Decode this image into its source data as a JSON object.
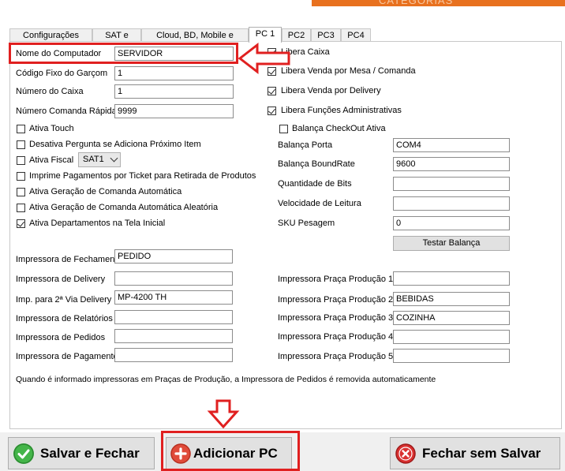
{
  "window": {
    "partial_title": "CATEGORIAS",
    "accent": "#e8711f"
  },
  "tabs": [
    {
      "label": "Configurações Gerais"
    },
    {
      "label": "SAT e CFE"
    },
    {
      "label": "Cloud, BD, Mobile e Balança"
    },
    {
      "label": "PC 1"
    },
    {
      "label": "PC2"
    },
    {
      "label": "PC3"
    },
    {
      "label": "PC4"
    }
  ],
  "left": {
    "nome_computador": {
      "label": "Nome do Computador",
      "value": "SERVIDOR"
    },
    "codigo_garcom": {
      "label": "Código Fixo do Garçom",
      "value": "1"
    },
    "numero_caixa": {
      "label": "Número do Caixa",
      "value": "1"
    },
    "numero_comanda": {
      "label": "Número Comanda Rápida",
      "value": "9999"
    },
    "ativa_touch": {
      "label": "Ativa Touch",
      "checked": false
    },
    "desativa_pergunta": {
      "label": "Desativa Pergunta se Adiciona Próximo Item",
      "checked": false
    },
    "ativa_fiscal": {
      "label": "Ativa Fiscal",
      "checked": false,
      "combo": "SAT1"
    },
    "imprime_pagamentos": {
      "label": "Imprime Pagamentos por Ticket para Retirada de Produtos",
      "checked": false
    },
    "ativa_comanda_auto": {
      "label": "Ativa Geração de Comanda Automática",
      "checked": false
    },
    "ativa_comanda_aleatoria": {
      "label": "Ativa Geração de Comanda Automática Aleatória",
      "checked": false
    },
    "ativa_departamentos": {
      "label": "Ativa Departamentos na Tela Inicial",
      "checked": true
    },
    "imp_fechamento": {
      "label": "Impressora de Fechamento",
      "value": "PEDIDO"
    },
    "imp_delivery": {
      "label": "Impressora de Delivery",
      "value": ""
    },
    "imp_segunda_via": {
      "label": "Imp. para 2ª Via Delivery",
      "value": "MP-4200 TH"
    },
    "imp_relatorios": {
      "label": "Impressora de Relatórios",
      "value": ""
    },
    "imp_pedidos": {
      "label": "Impressora de Pedidos",
      "value": ""
    },
    "imp_pagamento": {
      "label": "Impressora de Pagamento",
      "value": ""
    }
  },
  "right": {
    "libera_caixa": {
      "label": "Libera Caixa",
      "checked": true
    },
    "libera_mesa": {
      "label": "Libera Venda por Mesa / Comanda",
      "checked": true
    },
    "libera_delivery": {
      "label": "Libera Venda por Delivery",
      "checked": true
    },
    "libera_funcoes": {
      "label": "Libera Funções Administrativas",
      "checked": true
    },
    "balanca_checkout": {
      "label": "Balança CheckOut Ativa",
      "checked": false
    },
    "balanca_porta": {
      "label": "Balança Porta",
      "value": "COM4"
    },
    "balanca_boundrate": {
      "label": "Balança BoundRate",
      "value": "9600"
    },
    "qtd_bits": {
      "label": "Quantidade de Bits",
      "value": ""
    },
    "velocidade": {
      "label": "Velocidade de Leitura",
      "value": ""
    },
    "sku_pesagem": {
      "label": "SKU Pesagem",
      "value": "0"
    },
    "testar_balanca": "Testar Balança",
    "praca1": {
      "label": "Impressora Praça Produção 1",
      "value": ""
    },
    "praca2": {
      "label": "Impressora Praça Produção 2",
      "value": "BEBIDAS"
    },
    "praca3": {
      "label": "Impressora Praça Produção 3",
      "value": "COZINHA"
    },
    "praca4": {
      "label": "Impressora Praça Produção 4",
      "value": ""
    },
    "praca5": {
      "label": "Impressora Praça Produção 5",
      "value": ""
    }
  },
  "note": "Quando é informado impressoras em Praças de Produção, a Impressora de Pedidos é removida automaticamente",
  "buttons": {
    "salvar": "Salvar e Fechar",
    "adicionar": "Adicionar PC",
    "fechar": "Fechar sem Salvar"
  },
  "colors": {
    "green": "#3cb043",
    "red": "#e02020",
    "highlight": "#e02020"
  }
}
